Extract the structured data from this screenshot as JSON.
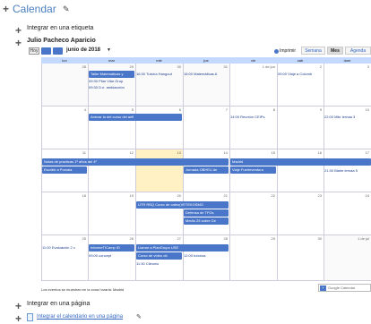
{
  "page": {
    "title": "Calendar",
    "menu": [
      {
        "label": "Integrar en una etiqueta"
      },
      {
        "label": "Julio Pacheco Aparicio"
      },
      {
        "label": "Integrar en una página"
      },
      {
        "label": "Integrar el calendario en una página",
        "is_link": true
      }
    ]
  },
  "toolbar": {
    "today": "Hoy",
    "prev": "◄",
    "next": "►",
    "month_label": "junio de 2018",
    "dropdown": "▼",
    "print": "Imprimir",
    "views": [
      "Semana",
      "Mes",
      "Agenda"
    ],
    "active_view": "Mes"
  },
  "days": [
    "lun",
    "mar",
    "mié",
    "jue",
    "vie",
    "sáb",
    "dom"
  ],
  "weeks": [
    {
      "nums": [
        "28",
        "29",
        "30",
        "31",
        "1 de jun",
        "2",
        "3"
      ]
    },
    {
      "nums": [
        "4",
        "5",
        "6",
        "7",
        "8",
        "9",
        "10"
      ]
    },
    {
      "nums": [
        "11",
        "12",
        "13",
        "14",
        "15",
        "16",
        "17"
      ]
    },
    {
      "nums": [
        "18",
        "19",
        "20",
        "21",
        "22",
        "23",
        "24"
      ]
    },
    {
      "nums": [
        "25",
        "26",
        "27",
        "28",
        "29",
        "30",
        "1 de jul"
      ]
    }
  ],
  "events": {
    "w0": {
      "bar1": "Taller Matemáticas y",
      "t1": "16:30 Tutoría Hangout",
      "t2": "16:00 Matemáticas A",
      "sat": "09:00 Viaje a Colomb",
      "l1": "09:30 Pilar Vilar Grup",
      "l2": "09:30 D.e. ambiacción"
    },
    "w1": {
      "bar1": "Anexar la del curso del aefi",
      "fri": "14:00 Reunión CEIPs",
      "sun": "22:00 Mikr lernaa 3"
    },
    "w2": {
      "bar1": "Notas de practicas 1º años del 4º",
      "bar2": "Madrid",
      "bar3": "Escribir a Pomaia",
      "bar4": "Jornada OBHEU de",
      "bar5": "Viaje Fuerteventura",
      "sun": "21:30 Blaire lernaa 5"
    },
    "w3": {
      "bar1": "UTR RBQ Curso de cateo(VETEKOSMO",
      "bar2": "Defensa de TFGs",
      "bar3": "Medio 25 sobre Ge"
    },
    "w4": {
      "mon": "11:00 Evaluación 2 c",
      "bar1": "InformeTICamp ID",
      "bar2": "Llamar a PlanGrupo USE",
      "bar3": "Curso de vídeo ob",
      "tue": "09:00 concept",
      "thu": "12:00 tutorías",
      "wed": "11:30 Cileonio",
      "sun": "1 de jul"
    }
  },
  "footer": {
    "timezone_note": "Los eventos se muestran en la zona horaria: Madrid",
    "google_calendar": "Google Calendar",
    "g": "+"
  },
  "icons": {
    "plus": "+",
    "pencil": "✎"
  },
  "colors": {
    "accent": "#4a76c9",
    "today": "#fff1c4",
    "header": "#c3d9ff"
  }
}
